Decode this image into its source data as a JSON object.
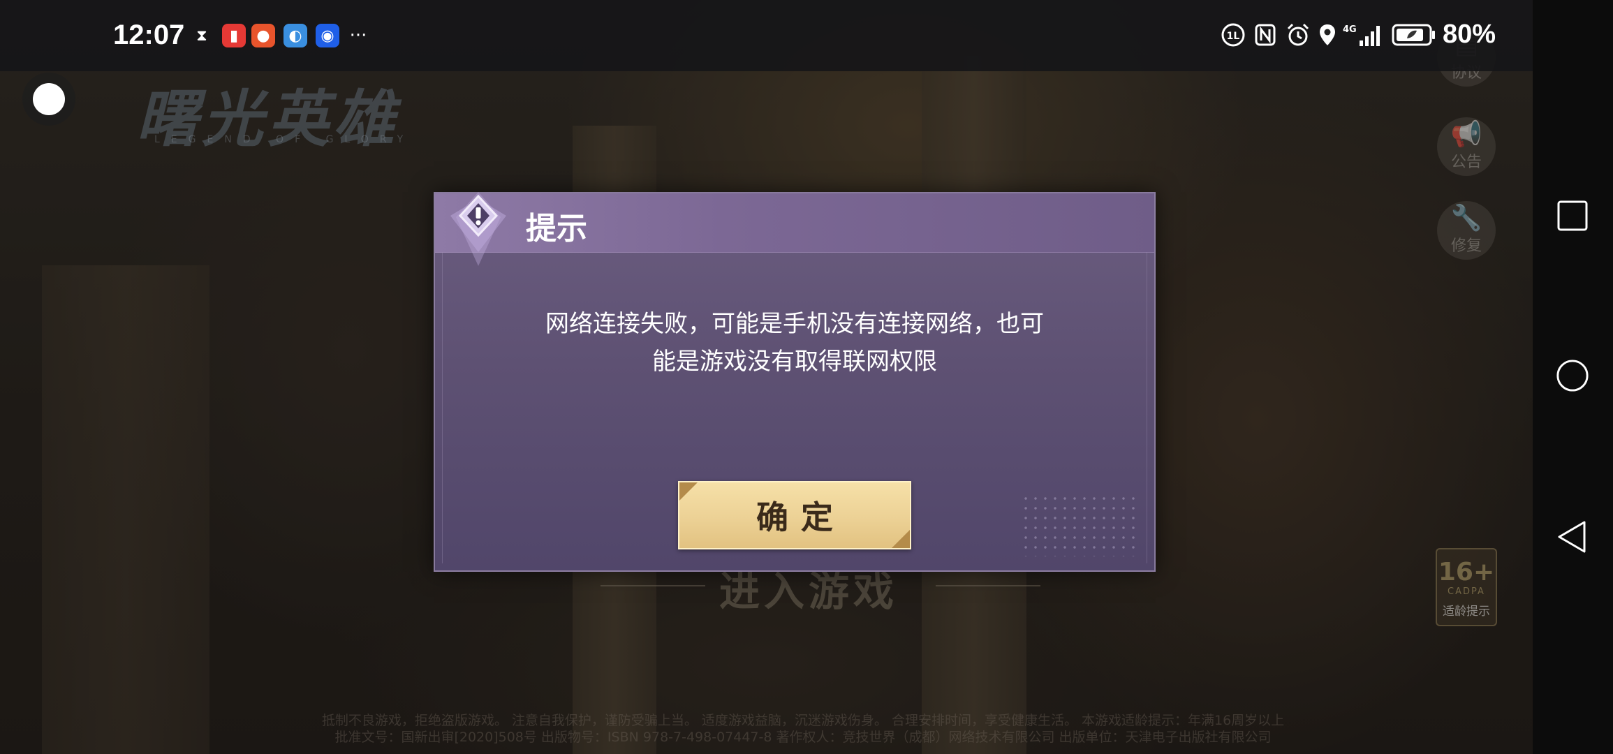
{
  "status_bar": {
    "time": "12:07",
    "overflow": "···",
    "battery_percent": "80%",
    "network": "4G"
  },
  "game": {
    "logo_title": "曙光英雄",
    "logo_subtitle": "LEGEND OF GLORY",
    "enter_game": "进入游戏",
    "side_buttons": {
      "agreement": "协议",
      "announcement": "公告",
      "repair": "修复"
    },
    "age_badge": {
      "rating": "16+",
      "org": "CADPA",
      "label": "适龄提示"
    },
    "disclaimer_line1": "抵制不良游戏，拒绝盗版游戏。 注意自我保护，谨防受骗上当。 适度游戏益脑，沉迷游戏伤身。 合理安排时间，享受健康生活。 本游戏适龄提示：年满16周岁以上",
    "disclaimer_line2": "批准文号：国新出审[2020]508号 出版物号：ISBN 978-7-498-07447-8 著作权人：竞技世界（成都）网络技术有限公司 出版单位：天津电子出版社有限公司"
  },
  "dialog": {
    "title": "提示",
    "message_line1": "网络连接失败，可能是手机没有连接网络，也可",
    "message_line2": "能是游戏没有取得联网权限",
    "confirm_label": "确定"
  },
  "colors": {
    "dialog_bg": "#5e5173",
    "header_bg": "#8e7aa6",
    "button_bg": "#ecd195",
    "button_text": "#3a2a1a"
  }
}
